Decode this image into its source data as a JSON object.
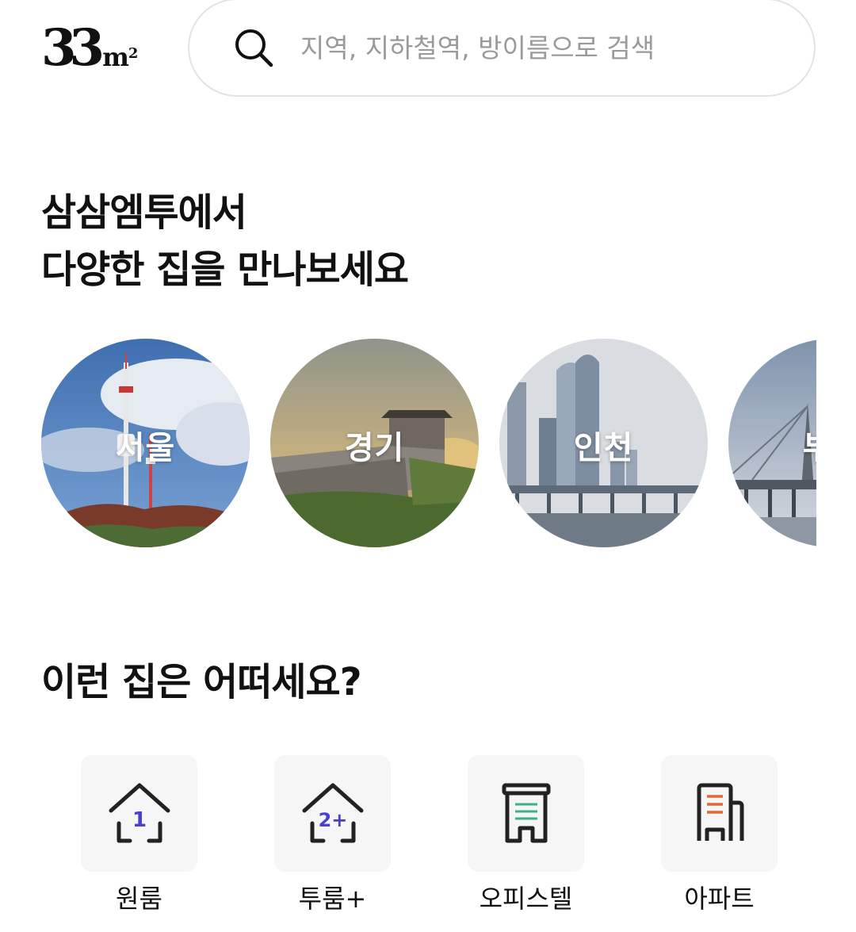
{
  "header": {
    "logo_number": "33",
    "logo_unit": "m",
    "logo_sup": "2",
    "search_placeholder": "지역, 지하철역, 방이름으로 검색"
  },
  "hero": {
    "title_line1": "삼삼엠투에서",
    "title_line2": "다양한 집을 만나보세요"
  },
  "regions": [
    {
      "label": "서울"
    },
    {
      "label": "경기"
    },
    {
      "label": "인천"
    },
    {
      "label": "부산"
    }
  ],
  "recommend": {
    "title": "이런 집은 어떠세요?"
  },
  "categories": [
    {
      "label": "원룸",
      "icon": "house-1-icon",
      "badge": "1",
      "accent": "#4a3fd0"
    },
    {
      "label": "투룸+",
      "icon": "house-2plus-icon",
      "badge": "2+",
      "accent": "#4a3fd0"
    },
    {
      "label": "오피스텔",
      "icon": "officetel-icon",
      "accent": "#3fae8c"
    },
    {
      "label": "아파트",
      "icon": "apartment-icon",
      "accent": "#e0683a"
    }
  ]
}
